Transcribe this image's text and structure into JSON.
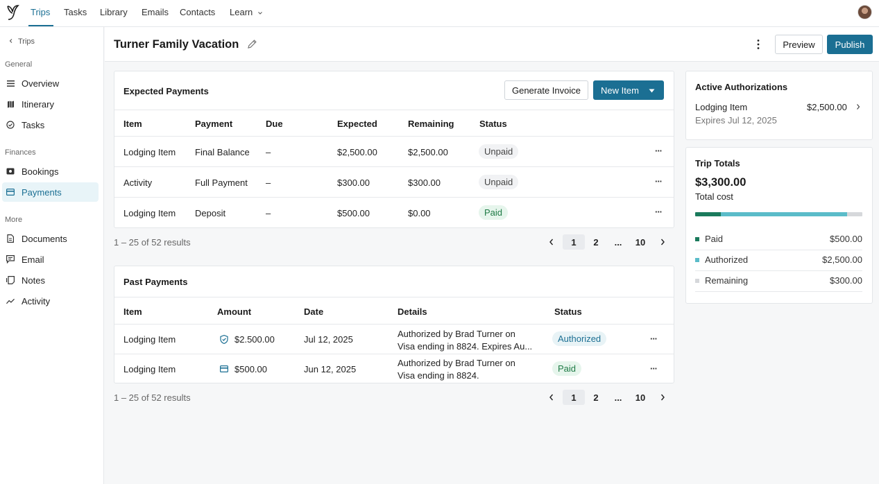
{
  "nav": {
    "items": [
      "Trips",
      "Tasks",
      "Library",
      "Emails",
      "Contacts",
      "Learn"
    ],
    "learn_chevron": "chevron-down-icon"
  },
  "sidebar": {
    "back_label": "Trips",
    "sections": [
      {
        "title": "General",
        "items": [
          "Overview",
          "Itinerary",
          "Tasks"
        ]
      },
      {
        "title": "Finances",
        "items": [
          "Bookings",
          "Payments"
        ]
      },
      {
        "title": "More",
        "items": [
          "Documents",
          "Email",
          "Notes",
          "Activity"
        ]
      }
    ],
    "active_item": "Payments"
  },
  "header": {
    "title": "Turner Family Vacation",
    "preview_label": "Preview",
    "publish_label": "Publish"
  },
  "expected_payments": {
    "title": "Expected Payments",
    "generate_invoice_label": "Generate Invoice",
    "new_item_label": "New Item",
    "columns": [
      "Item",
      "Payment",
      "Due",
      "Expected",
      "Remaining",
      "Status"
    ],
    "rows": [
      {
        "item": "Lodging Item",
        "payment": "Final Balance",
        "due": "–",
        "expected": "$2,500.00",
        "remaining": "$2,500.00",
        "status": "Unpaid"
      },
      {
        "item": "Activity",
        "payment": "Full Payment",
        "due": "–",
        "expected": "$300.00",
        "remaining": "$300.00",
        "status": "Unpaid"
      },
      {
        "item": "Lodging Item",
        "payment": "Deposit",
        "due": "–",
        "expected": "$500.00",
        "remaining": "$0.00",
        "status": "Paid"
      }
    ],
    "results_text": "1 – 25 of 52 results",
    "pagination": {
      "pages": [
        "1",
        "2",
        "...",
        "10"
      ],
      "current": "1"
    }
  },
  "past_payments": {
    "title": "Past Payments",
    "columns": [
      "Item",
      "Amount",
      "Date",
      "Details",
      "Status"
    ],
    "rows": [
      {
        "item": "Lodging Item",
        "amount_icon": "shield-check-icon",
        "amount": "$2.500.00",
        "date": "Jul 12, 2025",
        "details_line1": "Authorized by Brad Turner on",
        "details_line2": "Visa ending in 8824. Expires Au...",
        "status": "Authorized"
      },
      {
        "item": "Lodging Item",
        "amount_icon": "credit-card-icon",
        "amount": "$500.00",
        "date": "Jun 12, 2025",
        "details_line1": "Authorized by Brad Turner on",
        "details_line2": "Visa ending in 8824.",
        "status": "Paid"
      }
    ],
    "results_text": "1 – 25 of 52 results",
    "pagination": {
      "pages": [
        "1",
        "2",
        "...",
        "10"
      ],
      "current": "1"
    }
  },
  "active_authorizations": {
    "title": "Active Authorizations",
    "item": "Lodging Item",
    "amount": "$2,500.00",
    "expires": "Expires Jul 12, 2025"
  },
  "trip_totals": {
    "title": "Trip Totals",
    "total": "$3,300.00",
    "total_label": "Total cost",
    "paid_fraction": 0.1515,
    "authorized_fraction": 0.7576,
    "remaining_fraction": 0.0909,
    "legend": [
      {
        "label": "Paid",
        "value": "$500.00",
        "color": "#1a7a5c"
      },
      {
        "label": "Authorized",
        "value": "$2,500.00",
        "color": "#5bbcc9"
      },
      {
        "label": "Remaining",
        "value": "$300.00",
        "color": "#d6d8db"
      }
    ]
  }
}
